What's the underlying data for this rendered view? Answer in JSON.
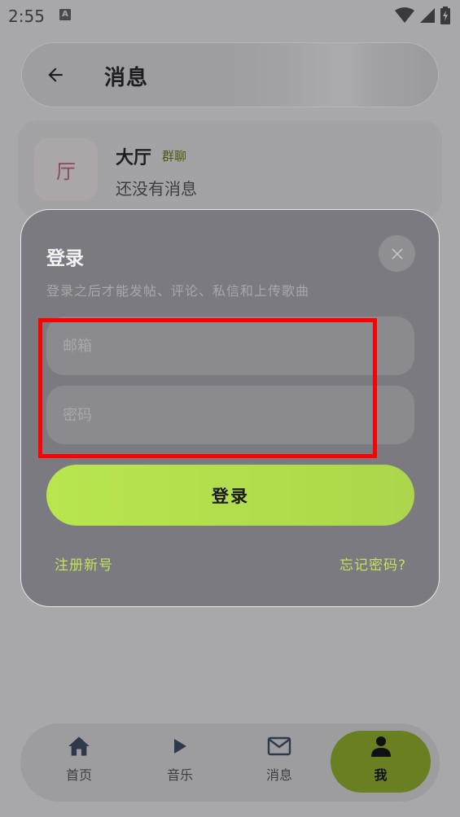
{
  "status_bar": {
    "time": "2:55",
    "notification_icon": "A",
    "icons": [
      "wifi-icon",
      "signal-icon",
      "battery-charging-icon"
    ]
  },
  "topbar": {
    "back_icon": "arrow-left-icon",
    "title": "消息"
  },
  "chat_list": {
    "items": [
      {
        "avatar_text": "厅",
        "name": "大厅",
        "badge": "群聊",
        "preview": "还没有消息"
      }
    ]
  },
  "dialog": {
    "title": "登录",
    "subtitle": "登录之后才能发帖、评论、私信和上传歌曲",
    "close_icon": "close-icon",
    "email_placeholder": "邮箱",
    "password_placeholder": "密码",
    "login_label": "登录",
    "register_label": "注册新号",
    "forgot_label": "忘记密码?"
  },
  "bottom_nav": {
    "items": [
      {
        "label": "首页",
        "icon": "home-icon",
        "active": false
      },
      {
        "label": "音乐",
        "icon": "play-icon",
        "active": false
      },
      {
        "label": "消息",
        "icon": "mail-icon",
        "active": false
      },
      {
        "label": "我",
        "icon": "person-icon",
        "active": true
      }
    ]
  },
  "colors": {
    "accent": "#b8e64e",
    "active_nav": "#6a7f22",
    "annotation": "#ff0000"
  }
}
